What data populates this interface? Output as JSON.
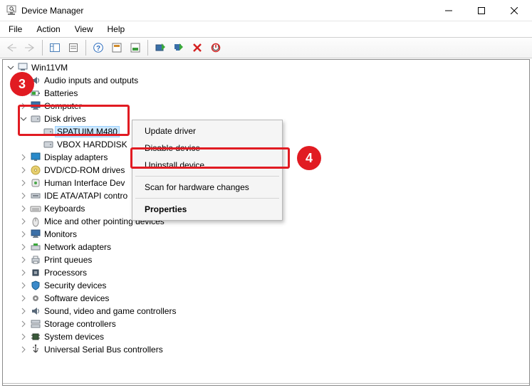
{
  "window": {
    "title": "Device Manager"
  },
  "menus": {
    "file": "File",
    "action": "Action",
    "view": "View",
    "help": "Help"
  },
  "root": {
    "name": "Win11VM"
  },
  "categories": [
    {
      "label": "Audio inputs and outputs",
      "expanded": false,
      "icon": "speaker"
    },
    {
      "label": "Batteries",
      "expanded": false,
      "icon": "battery"
    },
    {
      "label": "Computer",
      "expanded": false,
      "icon": "monitor"
    },
    {
      "label": "Disk drives",
      "expanded": true,
      "icon": "disk",
      "children": [
        {
          "label": "SPATUIM M480",
          "icon": "disk",
          "selected": true
        },
        {
          "label": "VBOX HARDDISK",
          "icon": "disk"
        }
      ]
    },
    {
      "label": "Display adapters",
      "expanded": false,
      "icon": "display"
    },
    {
      "label": "DVD/CD-ROM drives",
      "expanded": false,
      "icon": "cdrom"
    },
    {
      "label": "Human Interface Dev",
      "expanded": false,
      "icon": "hid"
    },
    {
      "label": "IDE ATA/ATAPI contro",
      "expanded": false,
      "icon": "ide"
    },
    {
      "label": "Keyboards",
      "expanded": false,
      "icon": "keyboard"
    },
    {
      "label": "Mice and other pointing devices",
      "expanded": false,
      "icon": "mouse"
    },
    {
      "label": "Monitors",
      "expanded": false,
      "icon": "monitor"
    },
    {
      "label": "Network adapters",
      "expanded": false,
      "icon": "network"
    },
    {
      "label": "Print queues",
      "expanded": false,
      "icon": "printer"
    },
    {
      "label": "Processors",
      "expanded": false,
      "icon": "cpu"
    },
    {
      "label": "Security devices",
      "expanded": false,
      "icon": "shield"
    },
    {
      "label": "Software devices",
      "expanded": false,
      "icon": "gear"
    },
    {
      "label": "Sound, video and game controllers",
      "expanded": false,
      "icon": "speaker"
    },
    {
      "label": "Storage controllers",
      "expanded": false,
      "icon": "storage"
    },
    {
      "label": "System devices",
      "expanded": false,
      "icon": "chip"
    },
    {
      "label": "Universal Serial Bus controllers",
      "expanded": false,
      "icon": "usb"
    }
  ],
  "context_menu": {
    "update": "Update driver",
    "disable": "Disable device",
    "uninstall": "Uninstall device",
    "scan": "Scan for hardware changes",
    "properties": "Properties"
  },
  "annotations": {
    "step3": "3",
    "step4": "4"
  }
}
